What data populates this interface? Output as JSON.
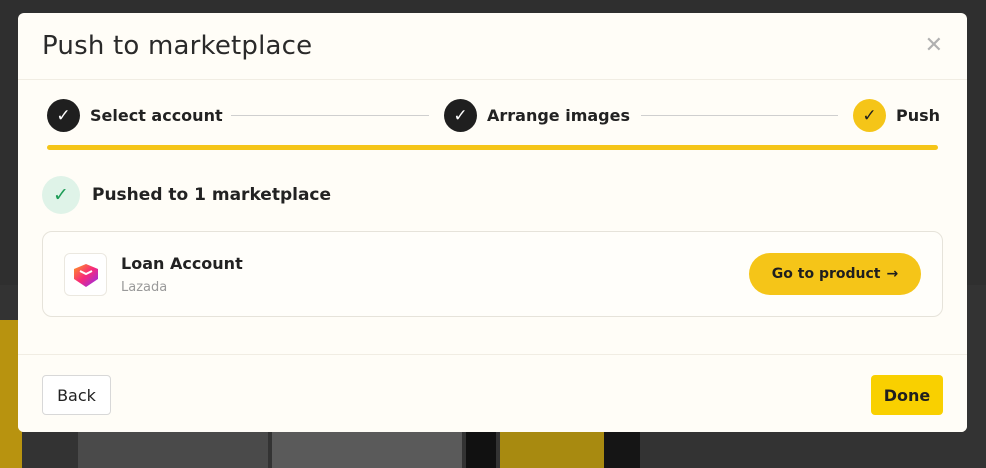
{
  "modal": {
    "title": "Push to marketplace",
    "close_icon": "close-icon"
  },
  "stepper": {
    "steps": [
      {
        "label": "Select account",
        "status": "done",
        "icon": "check-icon"
      },
      {
        "label": "Arrange images",
        "status": "done",
        "icon": "check-icon"
      },
      {
        "label": "Push",
        "status": "active",
        "icon": "check-icon"
      }
    ],
    "progress": 1.0
  },
  "result": {
    "text": "Pushed to 1 marketplace",
    "icon": "check-icon",
    "color": "#1e9c57"
  },
  "account": {
    "name": "Loan Account",
    "marketplace": "Lazada",
    "logo": "lazada-logo-icon",
    "action_label": "Go to product",
    "action_icon": "arrow-right-icon"
  },
  "footer": {
    "back_label": "Back",
    "done_label": "Done"
  },
  "colors": {
    "accent": "#f5c518",
    "done_button": "#f9d000",
    "dark": "#1f1f1f"
  }
}
